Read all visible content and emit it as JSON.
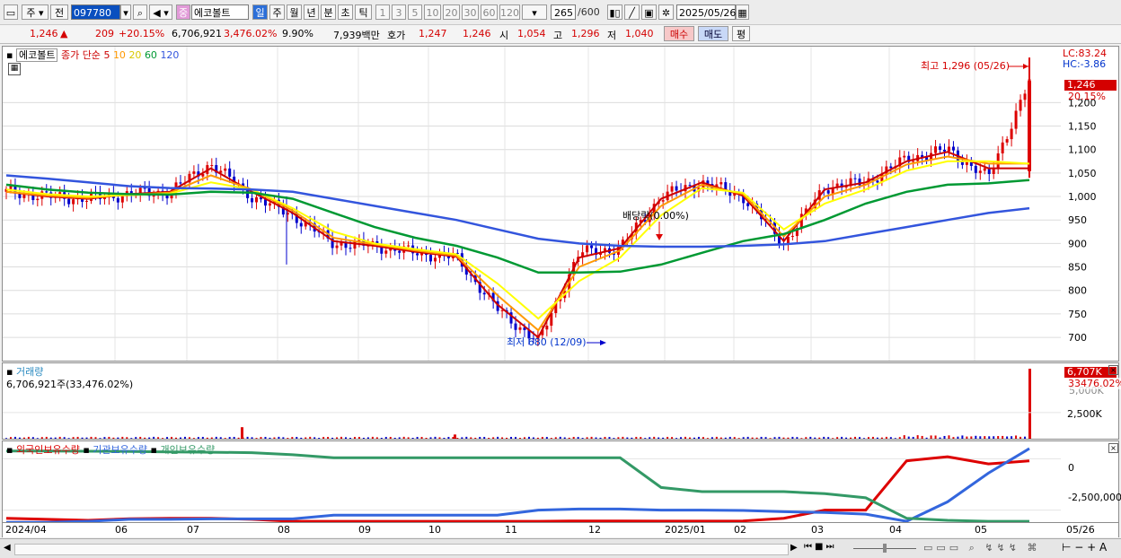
{
  "toolbar": {
    "period": "주",
    "prev": "전",
    "code": "097780",
    "stock_badge": "중",
    "stock_name": "에코볼트",
    "intervals": [
      "일",
      "주",
      "월",
      "년",
      "분",
      "초",
      "틱"
    ],
    "active_interval": "일",
    "numbers": [
      "1",
      "3",
      "5",
      "10",
      "20",
      "30",
      "60",
      "120"
    ],
    "count": "265",
    "count_total": "/600",
    "date": "2025/05/26"
  },
  "quote": {
    "price": "1,246",
    "arrow": "▲",
    "change": "209",
    "change_pct": "+20.15%",
    "volume": "6,706,921",
    "vol_pct": "3,476.02%",
    "turnover": "9.90%",
    "amount": "7,939백만",
    "bid_label": "호가",
    "ask": "1,247",
    "bid": "1,246",
    "open_label": "시",
    "open": "1,054",
    "high_label": "고",
    "high": "1,296",
    "low_label": "저",
    "low": "1,040",
    "buy_btn": "매수",
    "sell_btn": "매도",
    "eval_btn": "평"
  },
  "price_panel": {
    "name_tag": "에코볼트",
    "ma_title": "종가 단순",
    "ma_periods": [
      "5",
      "10",
      "20",
      "60",
      "120"
    ],
    "lc": "LC:83.24",
    "hc": "HC:-3.86",
    "high_note": "최고 1,296 (05/26)",
    "low_note": "최저 680 (12/09)",
    "dividend_note": "배당락(0.00%)",
    "last_price": "1,246",
    "last_pct": "20.15%",
    "y_ticks": [
      "1,200",
      "1,150",
      "1,100",
      "1,050",
      "1,000",
      "950",
      "900",
      "850",
      "800",
      "750",
      "700"
    ]
  },
  "volume_panel": {
    "title": "거래량",
    "value": "6,706,921주(33,476.02%)",
    "last": "6,707K",
    "last_pct": "33476.02%",
    "hidden_tick": "5,000K",
    "y_ticks": [
      "2,500K"
    ]
  },
  "holding_panel": {
    "series_labels": [
      "외국인보유수량",
      "기관보유수량",
      "개인보유수량"
    ],
    "y_ticks": [
      "0",
      "-2,500,000"
    ]
  },
  "x_axis": [
    "2024/04",
    "06",
    "07",
    "08",
    "09",
    "10",
    "11",
    "12",
    "2025/01",
    "02",
    "03",
    "04",
    "05",
    "05/26"
  ],
  "colors": {
    "ma5": "#cc0000",
    "ma10": "#ff9900",
    "ma20": "#ffff00",
    "ma60": "#009933",
    "ma120": "#3355dd",
    "up": "#dd0000",
    "down": "#0000cc",
    "foreign": "#dd0000",
    "inst": "#3366dd",
    "retail": "#339966"
  },
  "chart_data": {
    "type": "candlestick",
    "title": "에코볼트",
    "date_range": [
      "2024/04",
      "2025/05/26"
    ],
    "y_range": [
      660,
      1300
    ],
    "close_path": [
      {
        "date": "2024/04",
        "close": 1010
      },
      {
        "date": "2024/05",
        "close": 1000
      },
      {
        "date": "2024/06",
        "close": 995
      },
      {
        "date": "2024/07",
        "close": 1005
      },
      {
        "date": "2024/07 late",
        "close": 1010
      },
      {
        "date": "2024/08 early",
        "close": 1070
      },
      {
        "date": "2024/08 mid",
        "close": 1000
      },
      {
        "date": "2024/09",
        "close": 960
      },
      {
        "date": "2024/09 late",
        "close": 900
      },
      {
        "date": "2024/10",
        "close": 895
      },
      {
        "date": "2024/10 late",
        "close": 880
      },
      {
        "date": "2024/11",
        "close": 870
      },
      {
        "date": "2024/11 late",
        "close": 760
      },
      {
        "date": "2024/12/09",
        "close": 690
      },
      {
        "date": "2024/12 late",
        "close": 880
      },
      {
        "date": "2025/01",
        "close": 890
      },
      {
        "date": "2025/01 late",
        "close": 1000
      },
      {
        "date": "2025/02",
        "close": 1030
      },
      {
        "date": "2025/02 late",
        "close": 1000
      },
      {
        "date": "2025/03",
        "close": 900
      },
      {
        "date": "2025/03 late",
        "close": 1020
      },
      {
        "date": "2025/04",
        "close": 1030
      },
      {
        "date": "2025/04 late",
        "close": 1080
      },
      {
        "date": "2025/05",
        "close": 1100
      },
      {
        "date": "2025/05 late",
        "close": 1040
      },
      {
        "date": "2025/05/26",
        "close": 1246
      }
    ],
    "extremes": {
      "high": {
        "date": "05/26",
        "value": 1296
      },
      "low": {
        "date": "12/09",
        "value": 680
      }
    },
    "moving_averages": [
      {
        "name": "5",
        "path": [
          1010,
          1000,
          995,
          1005,
          1010,
          1060,
          1010,
          965,
          905,
          895,
          882,
          872,
          770,
          700,
          870,
          890,
          995,
          1030,
          1002,
          905,
          1015,
          1030,
          1075,
          1095,
          1060,
          1060
        ]
      },
      {
        "name": "10",
        "path": [
          1010,
          1002,
          997,
          1004,
          1008,
          1045,
          1015,
          970,
          912,
          898,
          885,
          874,
          790,
          715,
          850,
          885,
          980,
          1025,
          1005,
          915,
          1000,
          1025,
          1068,
          1085,
          1070,
          1070
        ]
      },
      {
        "name": "20",
        "path": [
          1015,
          1005,
          1000,
          1003,
          1006,
          1030,
          1015,
          975,
          925,
          900,
          888,
          877,
          815,
          740,
          820,
          870,
          960,
          1018,
          1008,
          930,
          985,
          1015,
          1055,
          1075,
          1075,
          1070
        ]
      },
      {
        "name": "60",
        "path": [
          1025,
          1015,
          1008,
          1005,
          1004,
          1010,
          1008,
          995,
          965,
          935,
          912,
          895,
          870,
          838,
          838,
          840,
          855,
          880,
          905,
          920,
          950,
          985,
          1010,
          1025,
          1028,
          1035
        ]
      },
      {
        "name": "120",
        "path": [
          1045,
          1038,
          1030,
          1022,
          1018,
          1017,
          1015,
          1010,
          995,
          980,
          965,
          950,
          930,
          910,
          900,
          895,
          893,
          893,
          895,
          898,
          905,
          920,
          935,
          950,
          965,
          975
        ]
      }
    ],
    "volume_spikes": [
      {
        "date": "2024/07 late",
        "value": 1100
      },
      {
        "date": "2024/10 late",
        "value": 400
      },
      {
        "date": "2025/05/26",
        "value": 6707
      }
    ],
    "holdings": {
      "ylim": [
        -3000000,
        500000
      ],
      "series": [
        {
          "name": "외국인보유수량",
          "path": [
            -2900000,
            -2950000,
            -3000000,
            -2920000,
            -2900000,
            -2900000,
            -2950000,
            -3050000,
            -3050000,
            -3050000,
            -3050000,
            -3050000,
            -3050000,
            -3050000,
            -3030000,
            -3030000,
            -3040000,
            -3040000,
            -3030000,
            -2900000,
            -2500000,
            -2500000,
            -100000,
            100000,
            -250000,
            -100000
          ]
        },
        {
          "name": "기관보유수량",
          "path": [
            -3100000,
            -3100000,
            -3050000,
            -2950000,
            -2950000,
            -2930000,
            -2930000,
            -2930000,
            -2750000,
            -2750000,
            -2750000,
            -2750000,
            -2750000,
            -2500000,
            -2450000,
            -2450000,
            -2500000,
            -2500000,
            -2520000,
            -2580000,
            -2620000,
            -2700000,
            -3050000,
            -2100000,
            -700000,
            500000
          ]
        },
        {
          "name": "개인보유수량",
          "path": [
            380000,
            380000,
            370000,
            360000,
            340000,
            320000,
            300000,
            200000,
            50000,
            50000,
            50000,
            50000,
            50000,
            50000,
            50000,
            50000,
            -1400000,
            -1600000,
            -1600000,
            -1600000,
            -1700000,
            -1900000,
            -2900000,
            -3000000,
            -3050000,
            -3050000
          ]
        }
      ]
    }
  }
}
